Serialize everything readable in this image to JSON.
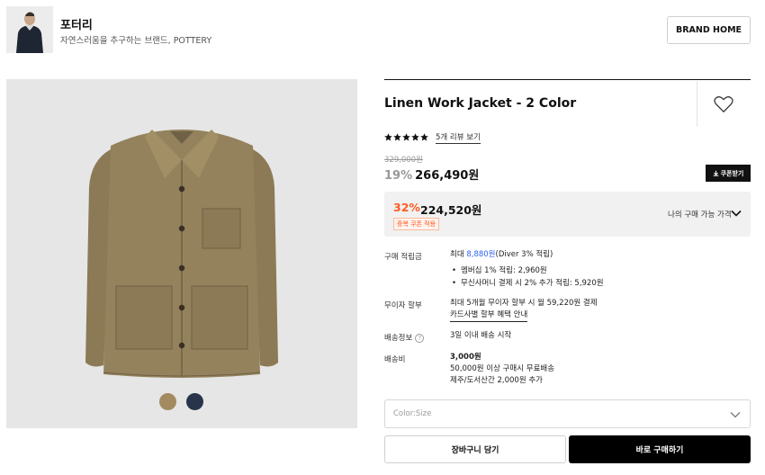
{
  "brand": {
    "name": "포터리",
    "subtitle": "자연스러움을 추구하는 브랜드, POTTERY",
    "home_button": "BRAND HOME"
  },
  "gallery": {
    "swatches": [
      {
        "name": "khaki-swatch",
        "color": "#a38a60"
      },
      {
        "name": "navy-swatch",
        "color": "#27344a"
      }
    ]
  },
  "product": {
    "title": "Linen Work Jacket - 2 Color",
    "rating_stars": 5,
    "review_link": "5개 리뷰 보기",
    "original_price": "329,000원",
    "discount_pct": "19%",
    "discount_price": "266,490원",
    "coupon_button": "쿠폰받기"
  },
  "best_price": {
    "pct": "32%",
    "price": "224,520원",
    "tag": "중복 쿠폰 적용",
    "label": "나의 구매 가능 가격"
  },
  "info": {
    "points_label": "구매 적립금",
    "points_prefix": "최대 ",
    "points_amount": "8,880원",
    "points_suffix": "(Diver 3% 적립)",
    "points_bullet_1": "멤버십 1% 적립: 2,960원",
    "points_bullet_2": "무신사머니 결제 시 2% 추가 적립: 5,920원",
    "installment_label": "무이자 할부",
    "installment_value": "최대 5개월 무이자 할부 시 월 59,220원 결제",
    "installment_link": "카드사별 할부 혜택 안내",
    "delivery_label": "배송정보",
    "delivery_help": "?",
    "delivery_value": "3일 이내 배송 시작",
    "shipping_label": "배송비",
    "shipping_fee": "3,000원",
    "shipping_line_1": "50,000원 이상 구매시 무료배송",
    "shipping_line_2": "제주/도서산간 2,000원 추가"
  },
  "option_select": {
    "placeholder": "Color:Size"
  },
  "actions": {
    "cart": "장바구니 담기",
    "buy": "바로 구매하기"
  },
  "colors": {
    "accent_orange": "#ff5a1f",
    "link_blue": "#2f64f4",
    "buy_bg": "#000000"
  }
}
